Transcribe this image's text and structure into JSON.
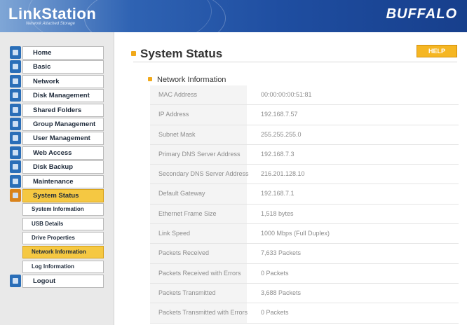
{
  "header": {
    "logo": "LinkStation",
    "logo_sub": "Network Attached Storage",
    "brand": "BUFFALO"
  },
  "sidebar": {
    "items": [
      {
        "label": "Home",
        "icon": "home-icon"
      },
      {
        "label": "Basic",
        "icon": "basic-icon"
      },
      {
        "label": "Network",
        "icon": "network-icon"
      },
      {
        "label": "Disk Management",
        "icon": "disk-icon"
      },
      {
        "label": "Shared Folders",
        "icon": "folder-icon"
      },
      {
        "label": "Group Management",
        "icon": "group-icon"
      },
      {
        "label": "User Management",
        "icon": "user-icon"
      },
      {
        "label": "Web Access",
        "icon": "globe-icon"
      },
      {
        "label": "Disk Backup",
        "icon": "backup-icon"
      },
      {
        "label": "Maintenance",
        "icon": "tools-icon"
      },
      {
        "label": "System Status",
        "icon": "chart-icon"
      }
    ],
    "subitems": [
      {
        "label": "System Information"
      },
      {
        "label": "USB Details"
      },
      {
        "label": "Drive Properties"
      },
      {
        "label": "Network Information"
      },
      {
        "label": "Log Information"
      }
    ],
    "logout": {
      "label": "Logout",
      "icon": "logout-icon"
    }
  },
  "main": {
    "title": "System Status",
    "help_label": "HELP",
    "section_title": "Network Information",
    "rows": [
      {
        "key": "MAC Address",
        "value": "00:00:00:00:51:81"
      },
      {
        "key": "IP Address",
        "value": "192.168.7.57"
      },
      {
        "key": "Subnet Mask",
        "value": "255.255.255.0"
      },
      {
        "key": "Primary DNS Server Address",
        "value": "192.168.7.3"
      },
      {
        "key": "Secondary DNS Server Address",
        "value": "216.201.128.10"
      },
      {
        "key": "Default Gateway",
        "value": "192.168.7.1"
      },
      {
        "key": "Ethernet Frame Size",
        "value": "1,518 bytes"
      },
      {
        "key": "Link Speed",
        "value": "1000 Mbps (Full Duplex)"
      },
      {
        "key": "Packets Received",
        "value": "7,633 Packets"
      },
      {
        "key": "Packets Received with Errors",
        "value": "0 Packets"
      },
      {
        "key": "Packets Transmitted",
        "value": "3,688 Packets"
      },
      {
        "key": "Packets Transmitted with Errors",
        "value": "0 Packets"
      }
    ]
  },
  "colors": {
    "header_blue": "#1f4ea1",
    "active_yellow": "#f5c842",
    "accent_orange": "#f1a91a"
  }
}
